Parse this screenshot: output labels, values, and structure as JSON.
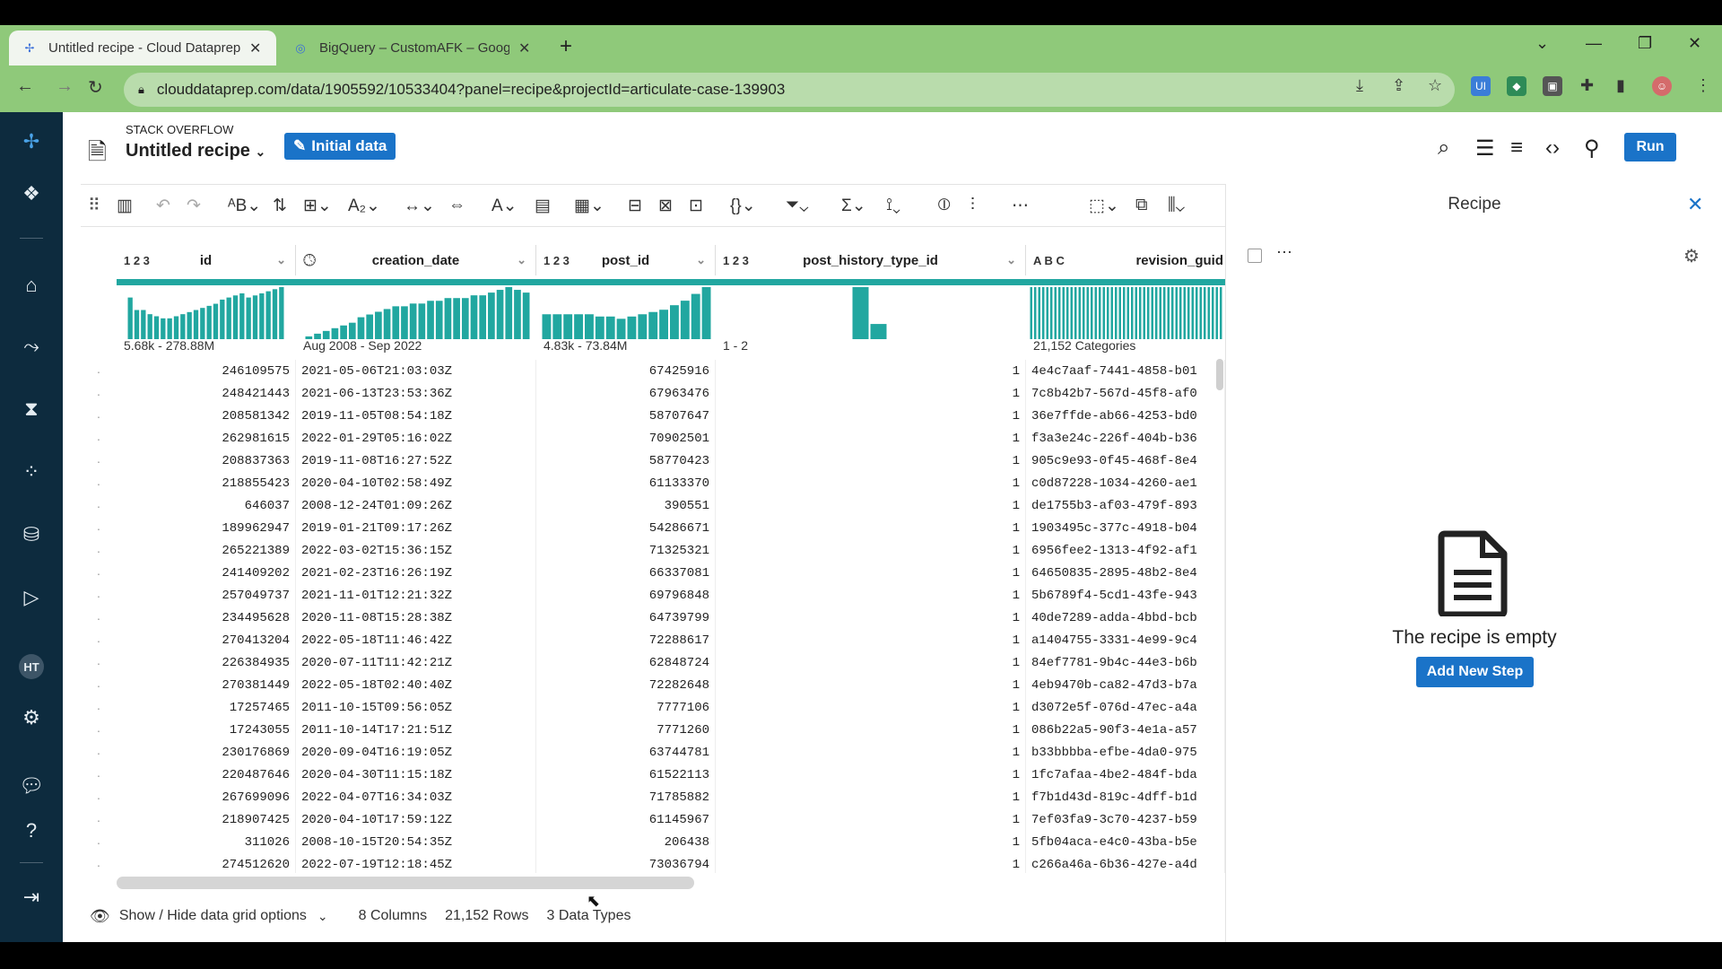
{
  "browser": {
    "tabs": [
      {
        "title": "Untitled recipe - Cloud Dataprep",
        "close": "✕"
      },
      {
        "title": "BigQuery – CustomAFK – Google Cloud",
        "close": "✕"
      }
    ],
    "new_tab": "+",
    "url": "clouddataprep.com/data/1905592/10533404?panel=recipe&projectId=articulate-case-139903"
  },
  "header": {
    "project": "STACK OVERFLOW",
    "recipe_name": "Untitled recipe",
    "initial_data": "Initial data",
    "run": "Run"
  },
  "rail": {
    "avatar_initials": "HT"
  },
  "columns": [
    {
      "type": "1 2 3",
      "name": "id",
      "range": "5.68k - 278.88M"
    },
    {
      "type": "clock",
      "name": "creation_date",
      "range": "Aug 2008 - Sep 2022"
    },
    {
      "type": "1 2 3",
      "name": "post_id",
      "range": "4.83k - 73.84M"
    },
    {
      "type": "1 2 3",
      "name": "post_history_type_id",
      "range": "1 - 2"
    },
    {
      "type": "A B C",
      "name": "revision_guid",
      "range": "21,152 Categories"
    }
  ],
  "histograms": {
    "id": [
      20,
      14,
      14,
      12,
      11,
      10,
      10,
      11,
      12,
      13,
      14,
      15,
      16,
      17,
      19,
      20,
      21,
      22,
      20,
      21,
      22,
      23,
      24,
      25
    ],
    "creation_date": [
      1,
      2,
      3,
      4,
      5,
      6,
      8,
      9,
      10,
      11,
      12,
      12,
      13,
      13,
      14,
      14,
      15,
      15,
      15,
      16,
      16,
      17,
      18,
      19,
      18,
      17
    ],
    "post_id": [
      11,
      11,
      11,
      11,
      11,
      10,
      10,
      9,
      10,
      11,
      12,
      13,
      15,
      17,
      20,
      23
    ],
    "post_history_type_id": [
      24,
      7
    ],
    "revision_guid": [
      1,
      1,
      1,
      1,
      1,
      1,
      1,
      1,
      1,
      1,
      1,
      1,
      1,
      1,
      1,
      1,
      1,
      1,
      1,
      1,
      1,
      1,
      1,
      1,
      1,
      1,
      1,
      1,
      1,
      1,
      1,
      1,
      1,
      1,
      1,
      1,
      1,
      1,
      1,
      1,
      1,
      1,
      1,
      1,
      1,
      1,
      1,
      1
    ]
  },
  "rows": [
    [
      "246109575",
      "2021-05-06T21:03:03Z",
      "67425916",
      "1",
      "4e4c7aaf-7441-4858-b01"
    ],
    [
      "248421443",
      "2021-06-13T23:53:36Z",
      "67963476",
      "1",
      "7c8b42b7-567d-45f8-af0"
    ],
    [
      "208581342",
      "2019-11-05T08:54:18Z",
      "58707647",
      "1",
      "36e7ffde-ab66-4253-bd0"
    ],
    [
      "262981615",
      "2022-01-29T05:16:02Z",
      "70902501",
      "1",
      "f3a3e24c-226f-404b-b36"
    ],
    [
      "208837363",
      "2019-11-08T16:27:52Z",
      "58770423",
      "1",
      "905c9e93-0f45-468f-8e4"
    ],
    [
      "218855423",
      "2020-04-10T02:58:49Z",
      "61133370",
      "1",
      "c0d87228-1034-4260-ae1"
    ],
    [
      "646037",
      "2008-12-24T01:09:26Z",
      "390551",
      "1",
      "de1755b3-af03-479f-893"
    ],
    [
      "189962947",
      "2019-01-21T09:17:26Z",
      "54286671",
      "1",
      "1903495c-377c-4918-b04"
    ],
    [
      "265221389",
      "2022-03-02T15:36:15Z",
      "71325321",
      "1",
      "6956fee2-1313-4f92-af1"
    ],
    [
      "241409202",
      "2021-02-23T16:26:19Z",
      "66337081",
      "1",
      "64650835-2895-48b2-8e4"
    ],
    [
      "257049737",
      "2021-11-01T12:21:32Z",
      "69796848",
      "1",
      "5b6789f4-5cd1-43fe-943"
    ],
    [
      "234495628",
      "2020-11-08T15:28:38Z",
      "64739799",
      "1",
      "40de7289-adda-4bbd-bcb"
    ],
    [
      "270413204",
      "2022-05-18T11:46:42Z",
      "72288617",
      "1",
      "a1404755-3331-4e99-9c4"
    ],
    [
      "226384935",
      "2020-07-11T11:42:21Z",
      "62848724",
      "1",
      "84ef7781-9b4c-44e3-b6b"
    ],
    [
      "270381449",
      "2022-05-18T02:40:40Z",
      "72282648",
      "1",
      "4eb9470b-ca82-47d3-b7a"
    ],
    [
      "17257465",
      "2011-10-15T09:56:05Z",
      "7777106",
      "1",
      "d3072e5f-076d-47ec-a4a"
    ],
    [
      "17243055",
      "2011-10-14T17:21:51Z",
      "7771260",
      "1",
      "086b22a5-90f3-4e1a-a57"
    ],
    [
      "230176869",
      "2020-09-04T16:19:05Z",
      "63744781",
      "1",
      "b33bbbba-efbe-4da0-975"
    ],
    [
      "220487646",
      "2020-04-30T11:15:18Z",
      "61522113",
      "1",
      "1fc7afaa-4be2-484f-bda"
    ],
    [
      "267699096",
      "2022-04-07T16:34:03Z",
      "71785882",
      "1",
      "f7b1d43d-819c-4dff-b1d"
    ],
    [
      "218907425",
      "2020-04-10T17:59:12Z",
      "61145967",
      "1",
      "7ef03fa9-3c70-4237-b59"
    ],
    [
      "311026",
      "2008-10-15T20:54:35Z",
      "206438",
      "1",
      "5fb04aca-e4c0-43ba-b5e"
    ],
    [
      "274512620",
      "2022-07-19T12:18:45Z",
      "73036794",
      "1",
      "c266a46a-6b36-427e-a4d"
    ]
  ],
  "footer": {
    "options": "Show / Hide data grid options",
    "columns": "8 Columns",
    "rows": "21,152 Rows",
    "types": "3 Data Types"
  },
  "recipe_panel": {
    "title": "Recipe",
    "empty": "The recipe is empty",
    "add_step": "Add New Step"
  },
  "colors": {
    "accent": "#1a73c8",
    "hist": "#21a7a0",
    "rail": "#0d2b3e",
    "chrome": "#8fc97a"
  }
}
